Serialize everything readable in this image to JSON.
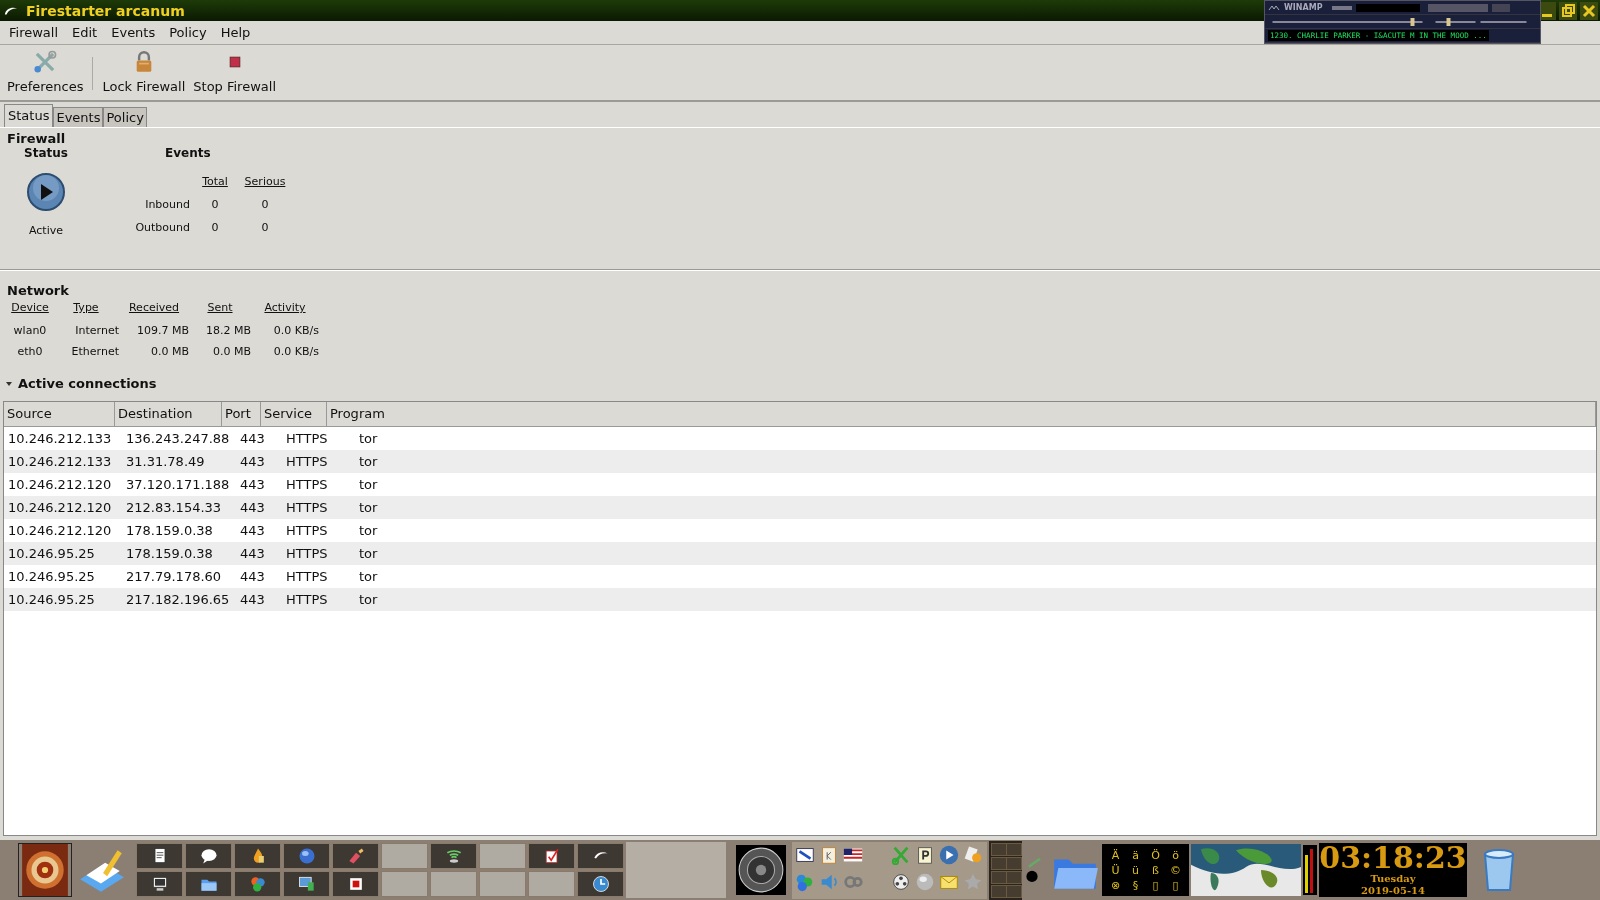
{
  "window": {
    "title": "Firestarter arcanum"
  },
  "winamp": {
    "title": "WINAMP",
    "track": "1230. CHARLIE PARKER - I&ACUTE M IN THE MOOD ..."
  },
  "menu": [
    "Firewall",
    "Edit",
    "Events",
    "Policy",
    "Help"
  ],
  "toolbar": [
    {
      "label": "Preferences",
      "kind": "preferences"
    },
    {
      "label": "Lock Firewall",
      "kind": "lock"
    },
    {
      "label": "Stop Firewall",
      "kind": "stop"
    }
  ],
  "tabs": [
    {
      "label": "Status",
      "selected": true
    },
    {
      "label": "Events",
      "selected": false
    },
    {
      "label": "Policy",
      "selected": false
    }
  ],
  "firewall": {
    "heading": "Firewall",
    "status_heading": "Status",
    "status": "Active",
    "events_heading": "Events",
    "columns": [
      "Total",
      "Serious"
    ],
    "rows": [
      {
        "label": "Inbound",
        "total": "0",
        "serious": "0"
      },
      {
        "label": "Outbound",
        "total": "0",
        "serious": "0"
      }
    ]
  },
  "network": {
    "heading": "Network",
    "columns": [
      "Device",
      "Type",
      "Received",
      "Sent",
      "Activity"
    ],
    "rows": [
      [
        "wlan0",
        "Internet",
        "109.7 MB",
        "18.2 MB",
        "0.0 KB/s"
      ],
      [
        "eth0",
        "Ethernet",
        "0.0 MB",
        "0.0 MB",
        "0.0 KB/s"
      ]
    ]
  },
  "connections": {
    "heading": "Active connections",
    "expanded": true,
    "columns": [
      "Source",
      "Destination",
      "Port",
      "Service",
      "Program"
    ],
    "rows": [
      [
        "10.246.212.133",
        "136.243.247.88",
        "443",
        "HTTPS",
        "tor"
      ],
      [
        "10.246.212.133",
        "31.31.78.49",
        "443",
        "HTTPS",
        "tor"
      ],
      [
        "10.246.212.120",
        "37.120.171.188",
        "443",
        "HTTPS",
        "tor"
      ],
      [
        "10.246.212.120",
        "212.83.154.33",
        "443",
        "HTTPS",
        "tor"
      ],
      [
        "10.246.212.120",
        "178.159.0.38",
        "443",
        "HTTPS",
        "tor"
      ],
      [
        "10.246.95.25",
        "178.159.0.38",
        "443",
        "HTTPS",
        "tor"
      ],
      [
        "10.246.95.25",
        "217.79.178.60",
        "443",
        "HTTPS",
        "tor"
      ],
      [
        "10.246.95.25",
        "217.182.196.65",
        "443",
        "HTTPS",
        "tor"
      ]
    ]
  },
  "taskbar": {
    "characters": [
      "Ä",
      "ä",
      "Ö",
      "ö",
      "Ü",
      "ü",
      "ß",
      "©",
      "⊗",
      "§",
      "▯",
      "▯"
    ],
    "clock": {
      "time": "03:18:23",
      "day": "Tuesday",
      "date": "2019-05-14"
    }
  }
}
